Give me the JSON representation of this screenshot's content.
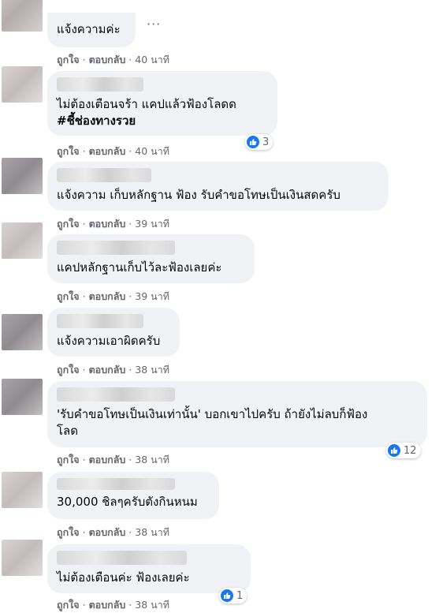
{
  "comments": [
    {
      "text": "แจ้งความค่ะ",
      "like": "ถูกใจ",
      "reply": "ตอบกลับ",
      "time": "40 นาที"
    },
    {
      "text": "ไม่ต้องเตือนจร้า แคปแล้วฟ้องโลดด",
      "hashtag": "#ชี้ช่องทางรวย",
      "like": "ถูกใจ",
      "reply": "ตอบกลับ",
      "time": "40 นาที",
      "reactions": "3"
    },
    {
      "text": "แจ้งความ เก็บหลักฐาน ฟ้อง รับคำขอโทษเป็นเงินสดครับ",
      "like": "ถูกใจ",
      "reply": "ตอบกลับ",
      "time": "39 นาที"
    },
    {
      "text": "แคปหลักฐานเก็บไว้ละฟ้องเลยค่ะ",
      "like": "ถูกใจ",
      "reply": "ตอบกลับ",
      "time": "39 นาที"
    },
    {
      "text": "แจ้งความเอาผิดครับ",
      "like": "ถูกใจ",
      "reply": "ตอบกลับ",
      "time": "38 นาที"
    },
    {
      "text": "'รับคำขอโทษเป็นเงินเท่านั้น' บอกเขาไปครับ ถ้ายังไม่ลบก็ฟ้อง\nโลด",
      "like": "ถูกใจ",
      "reply": "ตอบกลับ",
      "time": "38 นาที",
      "reactions": "12"
    },
    {
      "text": "30,000 ชิลๆครับตังกินหนม",
      "like": "ถูกใจ",
      "reply": "ตอบกลับ",
      "time": "38 นาที"
    },
    {
      "text": "ไม่ต้องเตือนค่ะ ฟ้องเลยค่ะ",
      "like": "ถูกใจ",
      "reply": "ตอบกลับ",
      "time": "38 นาที",
      "reactions": "1"
    }
  ],
  "more_label": "···",
  "separator": "·",
  "colors": {
    "bubble": "#f0f2f5",
    "meta": "#65676b",
    "like": "#1877f2"
  }
}
